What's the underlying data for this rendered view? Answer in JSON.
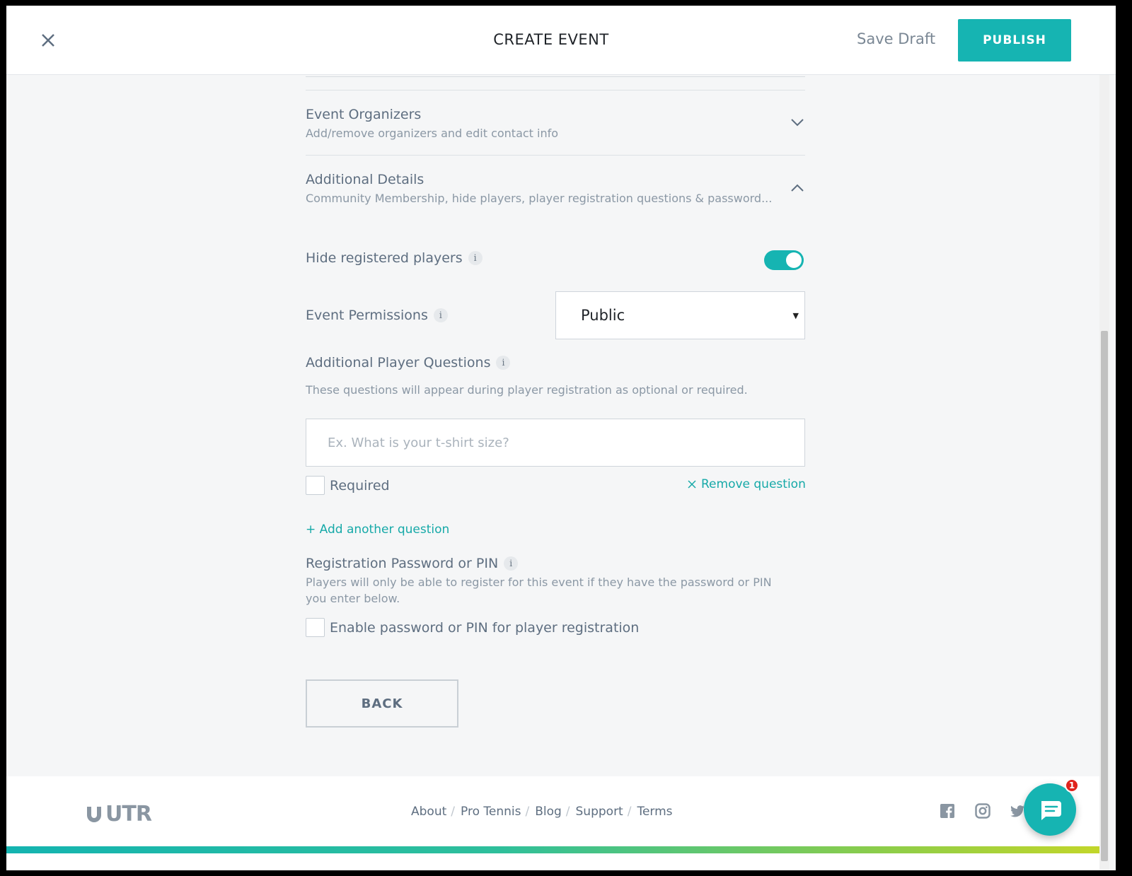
{
  "header": {
    "title": "CREATE EVENT",
    "save_draft_label": "Save Draft",
    "publish_label": "PUBLISH"
  },
  "sections": {
    "organizers": {
      "title": "Event Organizers",
      "subtitle": "Add/remove organizers and edit contact info"
    },
    "additional": {
      "title": "Additional Details",
      "subtitle": "Community Membership, hide players, player registration questions & password..."
    }
  },
  "hide_players": {
    "label": "Hide registered players",
    "info": "i",
    "enabled": true
  },
  "permissions": {
    "label": "Event Permissions",
    "info": "i",
    "selected": "Public"
  },
  "questions": {
    "title": "Additional Player Questions",
    "info": "i",
    "help": "These questions will appear during player registration as optional or required.",
    "placeholder": "Ex. What is your t-shirt size?",
    "required_label": "Required",
    "remove_label": "Remove question",
    "add_label": "+ Add another question"
  },
  "password": {
    "title": "Registration Password or PIN",
    "info": "i",
    "help_line1": "Players will only be able to register for this event if they have the password or PIN",
    "help_line2": "you enter below.",
    "enable_label": "Enable password or PIN for player registration"
  },
  "back_label": "BACK",
  "footer": {
    "logo_text": "UTR",
    "links": [
      "About",
      "Pro Tennis",
      "Blog",
      "Support",
      "Terms"
    ],
    "separator": "/"
  },
  "chat": {
    "badge_count": "1"
  },
  "colors": {
    "accent": "#16b4b2",
    "badge": "#e0231c"
  }
}
